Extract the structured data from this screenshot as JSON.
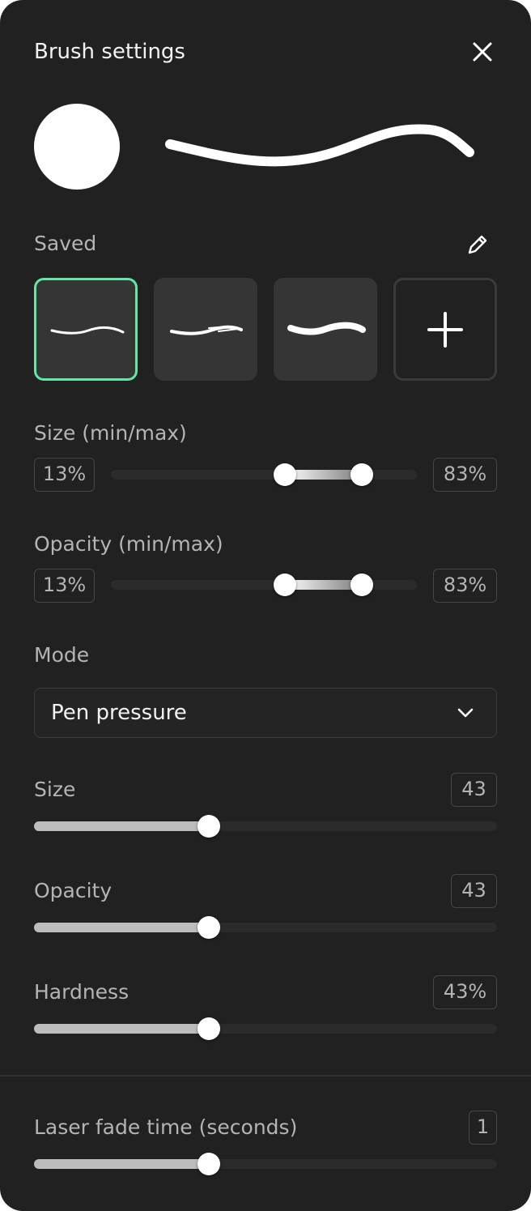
{
  "header": {
    "title": "Brush settings",
    "close_icon": "close-icon"
  },
  "saved": {
    "label": "Saved",
    "edit_icon": "pencil-icon",
    "presets": [
      {
        "name": "thin smooth stroke",
        "selected": true
      },
      {
        "name": "rough textured stroke",
        "selected": false
      },
      {
        "name": "thick marker stroke",
        "selected": false
      }
    ],
    "add_icon": "plus-icon"
  },
  "size_range": {
    "label": "Size (min/max)",
    "min": "13%",
    "max": "83%",
    "handle_low": 0.57,
    "handle_high": 0.82
  },
  "opacity_range": {
    "label": "Opacity (min/max)",
    "min": "13%",
    "max": "83%",
    "handle_low": 0.57,
    "handle_high": 0.82
  },
  "mode": {
    "label": "Mode",
    "selected": "Pen pressure",
    "chevron_icon": "chevron-down-icon"
  },
  "size": {
    "label": "Size",
    "value": "43",
    "level": 0.38
  },
  "opacity": {
    "label": "Opacity",
    "value": "43",
    "level": 0.38
  },
  "hardness": {
    "label": "Hardness",
    "value": "43%",
    "level": 0.38
  },
  "laser": {
    "label": "Laser fade time (seconds)",
    "value": "1",
    "level": 0.38
  },
  "colors": {
    "panel": "#212121",
    "accent": "#63e6a6",
    "thumb": "#ffffff"
  }
}
